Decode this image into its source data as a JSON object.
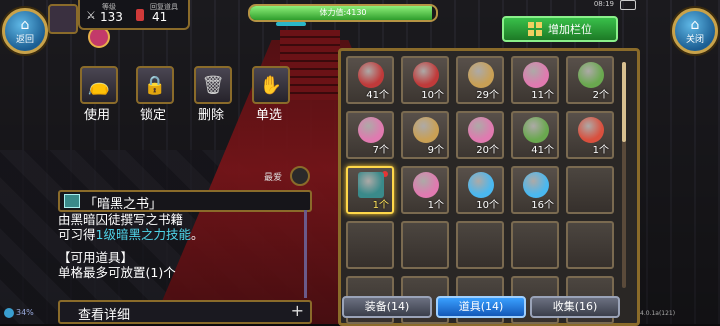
{
  "top": {
    "back_label": "返回",
    "close_label": "关闭",
    "level_label": "等级",
    "level_value": "133",
    "rebirth_label": "回复道具",
    "rebirth_value": "41",
    "hp_text": "体力值:4130",
    "hp_fraction": 0.98,
    "expand_label": "增加栏位",
    "clock": "08:19"
  },
  "actions": [
    {
      "label": "使用",
      "icon": "potion-bag-icon"
    },
    {
      "label": "锁定",
      "icon": "lock-icon"
    },
    {
      "label": "删除",
      "icon": "trash-icon"
    },
    {
      "label": "单选",
      "icon": "hand-icon"
    }
  ],
  "favorite_label": "最爱",
  "item": {
    "title": "「暗黑之书」",
    "desc_line1": "由黑暗囚徒撰写之书籍",
    "desc_line2_pre": "可习得",
    "desc_line2_hl": "1级暗黑之力技能",
    "desc_line2_post": "。",
    "desc_line3": "【可用道具】",
    "desc_line4": "单格最多可放置(1)个",
    "detail_label": "查看详细",
    "detail_plus": "+"
  },
  "battery_pct": "34%",
  "version": "4.0.1a(121)",
  "inventory": [
    {
      "count": "41个",
      "icon": "red-potion-icon",
      "color": "#c03a3a"
    },
    {
      "count": "10个",
      "icon": "red-potion-icon",
      "color": "#c03a3a"
    },
    {
      "count": "29个",
      "icon": "gold-pouch-icon",
      "color": "#c9a055"
    },
    {
      "count": "11个",
      "icon": "pie-slice-icon",
      "color": "#e07ab0"
    },
    {
      "count": "2个",
      "icon": "green-pouch-icon",
      "color": "#6aa84f"
    },
    {
      "count": "7个",
      "icon": "pie-slice-icon",
      "color": "#e07ab0"
    },
    {
      "count": "9个",
      "icon": "gold-pouch-icon",
      "color": "#c9a055"
    },
    {
      "count": "20个",
      "icon": "pie-slice-icon",
      "color": "#e07ab0"
    },
    {
      "count": "41个",
      "icon": "green-pouch-icon",
      "color": "#6aa84f"
    },
    {
      "count": "1个",
      "icon": "gift-box-icon",
      "color": "#d9503e"
    },
    {
      "count": "1个",
      "icon": "dark-book-icon",
      "color": "#3a8a8a",
      "selected": true
    },
    {
      "count": "1个",
      "icon": "pie-slice-icon",
      "color": "#e07ab0"
    },
    {
      "count": "10个",
      "icon": "blue-gem-icon",
      "color": "#4ab8f0"
    },
    {
      "count": "16个",
      "icon": "blue-gem-icon",
      "color": "#4ab8f0"
    }
  ],
  "tabs": [
    {
      "label": "装备(14)",
      "active": false
    },
    {
      "label": "道具(14)",
      "active": true
    },
    {
      "label": "收集(16)",
      "active": false
    }
  ]
}
